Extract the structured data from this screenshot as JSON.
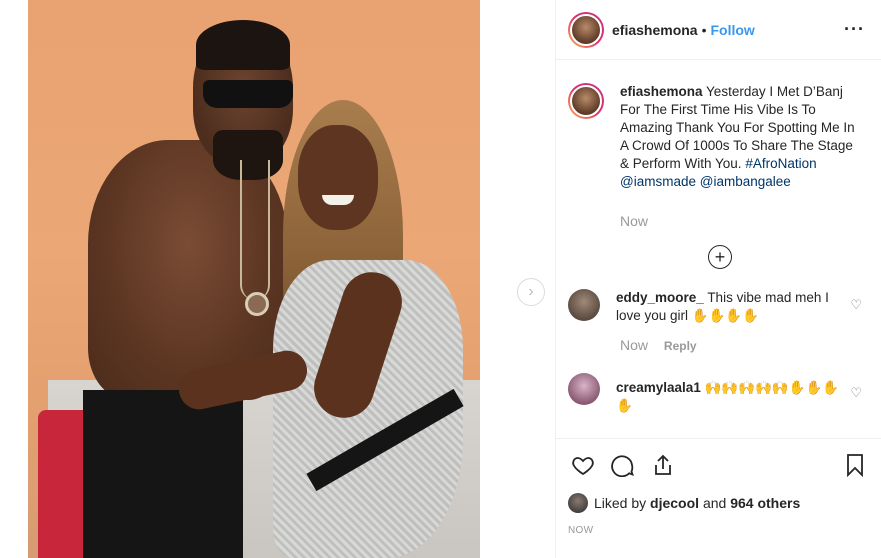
{
  "post": {
    "image_alt": "Photo of two people posing together",
    "next_arrow": "›"
  },
  "header": {
    "username": "efiashemona",
    "separator": "•",
    "follow_label": "Follow",
    "more_icon": "more-options-icon",
    "more_label": "···"
  },
  "caption": {
    "username": "efiashemona",
    "text": "Yesterday I Met D’Banj For The First Time His Vibe Is To Amazing Thank You For Spotting Me In A Crowd Of 1000s To Share The Stage & Perform With You.",
    "hashtag": "#AfroNation",
    "mention1": "@iamsmade",
    "mention2": "@iambangalee",
    "time": "Now"
  },
  "load_more": {
    "label": "+"
  },
  "comments": [
    {
      "username": "eddy_moore_",
      "text": "This vibe mad meh I love you girl ✋✋✋✋",
      "time": "Now",
      "reply_label": "Reply"
    },
    {
      "username": "creamylaala1",
      "text": "🙌🙌🙌🙌🙌✋✋✋✋"
    }
  ],
  "actions": {
    "like_icon": "heart-icon",
    "comment_icon": "comment-icon",
    "share_icon": "share-icon",
    "save_icon": "bookmark-icon"
  },
  "likes": {
    "prefix": "Liked by",
    "user": "djecool",
    "and": "and",
    "others": "964 others"
  },
  "post_time": "NOW",
  "colors": {
    "link_blue": "#3897f0",
    "hashtag_blue": "#003569",
    "muted": "#999999",
    "text": "#262626"
  }
}
